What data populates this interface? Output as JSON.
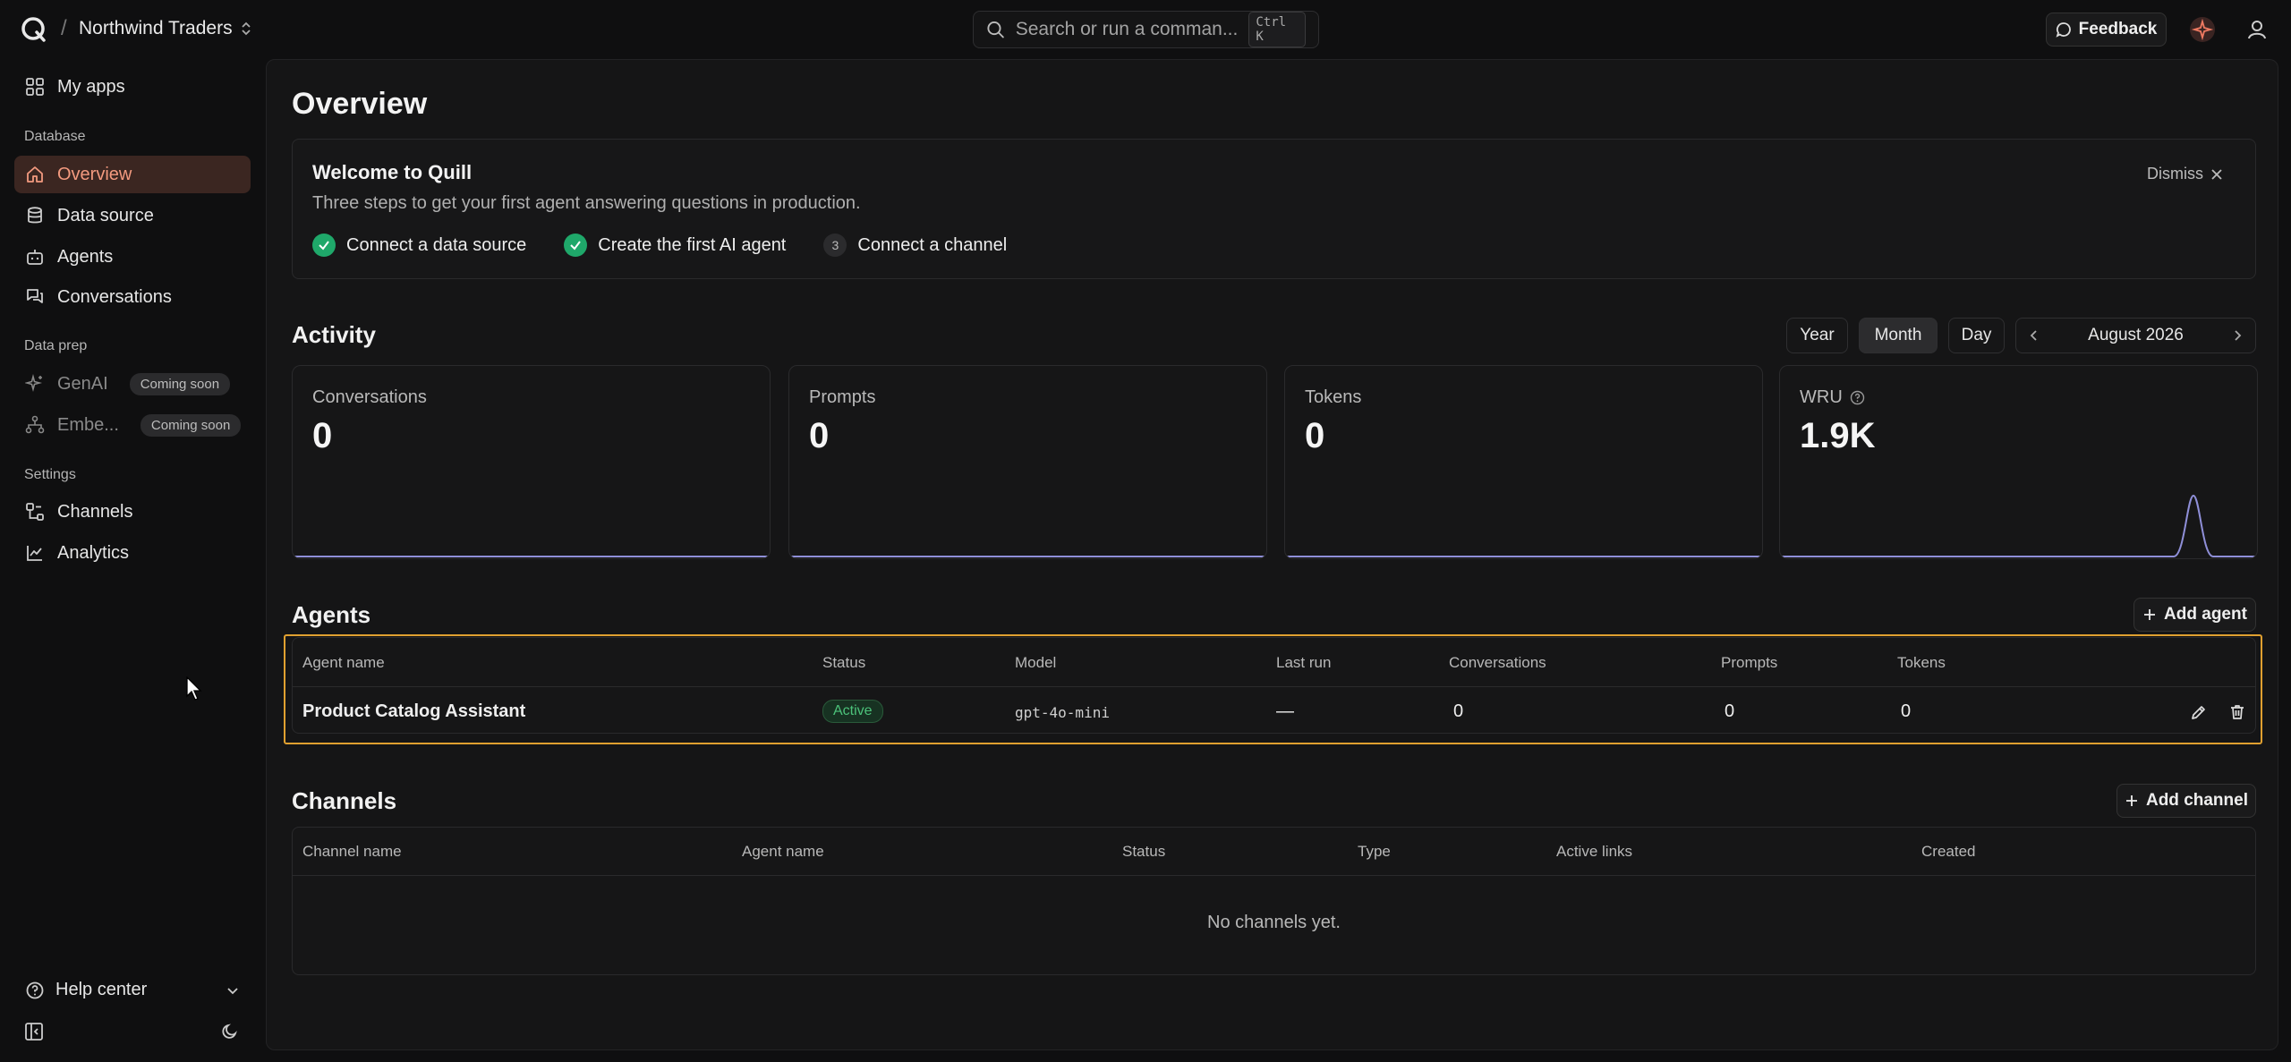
{
  "header": {
    "org_name": "Northwind Traders",
    "search_placeholder": "Search or run a comman...",
    "search_shortcut": "Ctrl K",
    "feedback_label": "Feedback"
  },
  "sidebar": {
    "my_apps": "My apps",
    "section_database": "Database",
    "database_items": [
      "Overview",
      "Data source",
      "Agents",
      "Conversations"
    ],
    "section_data_prep": "Data prep",
    "data_prep_items": [
      {
        "label": "GenAI",
        "badge": "Coming soon"
      },
      {
        "label": "Embe...",
        "badge": "Coming soon"
      }
    ],
    "section_settings": "Settings",
    "settings_items": [
      "Channels",
      "Analytics"
    ],
    "help_center": "Help center"
  },
  "main": {
    "title": "Overview",
    "welcome": {
      "title": "Welcome to Quill",
      "subtitle": "Three steps to get your first agent answering questions in production.",
      "dismiss": "Dismiss",
      "steps": [
        {
          "label": "Connect a data source",
          "done": true
        },
        {
          "label": "Create the first AI agent",
          "done": true
        },
        {
          "label": "Connect a channel",
          "done": false,
          "number": "3"
        }
      ]
    },
    "activity": {
      "title": "Activity",
      "ranges": [
        "Year",
        "Month",
        "Day"
      ],
      "selected_range": "Month",
      "period": "August 2026",
      "cards": [
        {
          "label": "Conversations",
          "value": "0"
        },
        {
          "label": "Prompts",
          "value": "0"
        },
        {
          "label": "Tokens",
          "value": "0"
        },
        {
          "label": "WRU",
          "value": "1.9K"
        }
      ]
    },
    "agents": {
      "title": "Agents",
      "add_label": "Add agent",
      "columns": [
        "Agent name",
        "Status",
        "Model",
        "Last run",
        "Conversations",
        "Prompts",
        "Tokens"
      ],
      "rows": [
        {
          "name": "Product Catalog Assistant",
          "status": "Active",
          "model": "gpt-4o-mini",
          "last_run": "—",
          "conversations": "0",
          "prompts": "0",
          "tokens": "0"
        }
      ]
    },
    "channels": {
      "title": "Channels",
      "add_label": "Add channel",
      "columns": [
        "Channel name",
        "Agent name",
        "Status",
        "Type",
        "Active links",
        "Created"
      ],
      "empty": "No channels yet."
    }
  },
  "colors": {
    "accent": "#f39a7f",
    "active_bg": "#3b2621",
    "success": "#1fa86a",
    "highlight": "#e0a030",
    "spark": "#8f8fd8"
  }
}
